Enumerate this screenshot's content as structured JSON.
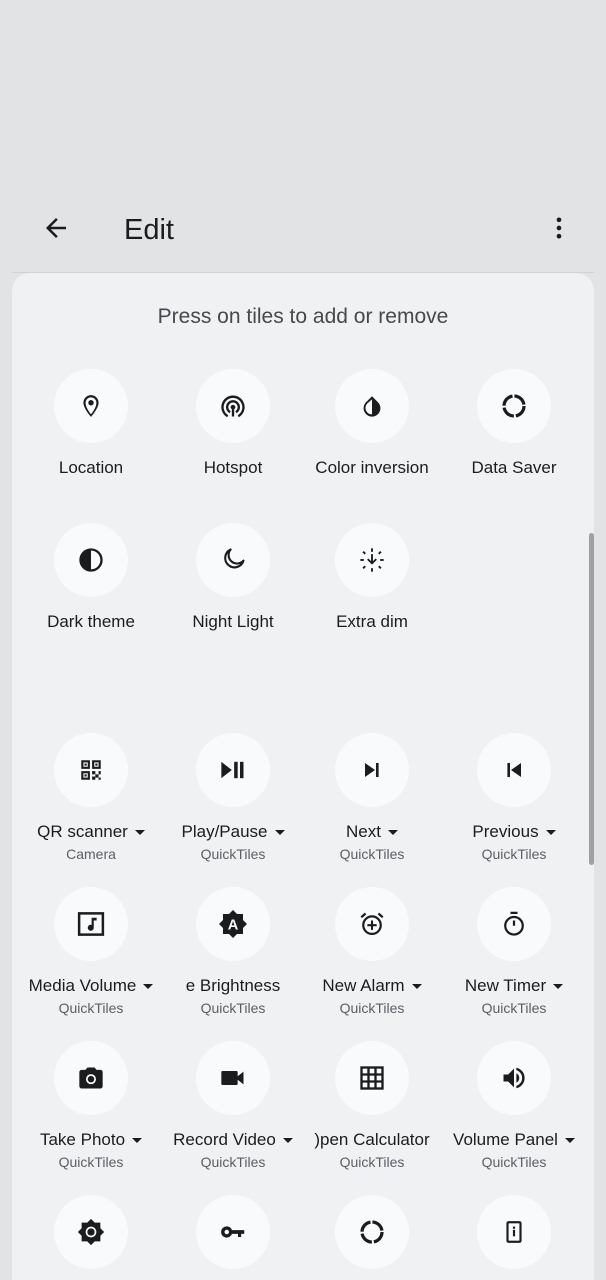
{
  "appbar": {
    "title": "Edit"
  },
  "instruction": "Press on tiles to add or remove",
  "available_tiles": [
    {
      "label": "Location",
      "icon": "location-pin-icon"
    },
    {
      "label": "Hotspot",
      "icon": "hotspot-icon"
    },
    {
      "label": "Color inversion",
      "icon": "color-inversion-icon"
    },
    {
      "label": "Data Saver",
      "icon": "data-saver-icon"
    },
    {
      "label": "Dark theme",
      "icon": "dark-theme-icon"
    },
    {
      "label": "Night Light",
      "icon": "moon-icon"
    },
    {
      "label": "Extra dim",
      "icon": "extra-dim-icon"
    }
  ],
  "app_tiles": [
    {
      "label": "QR scanner",
      "sub": "Camera",
      "icon": "qr-code-icon"
    },
    {
      "label": "Play/Pause",
      "sub": "QuickTiles",
      "icon": "play-pause-icon"
    },
    {
      "label": "Next",
      "sub": "QuickTiles",
      "icon": "skip-next-icon"
    },
    {
      "label": "Previous",
      "sub": "QuickTiles",
      "icon": "skip-previous-icon"
    },
    {
      "label": "Media Volume",
      "sub": "QuickTiles",
      "icon": "music-note-icon"
    },
    {
      "label": "e Brightness",
      "sub": "QuickTiles",
      "icon": "auto-brightness-icon"
    },
    {
      "label": "New Alarm",
      "sub": "QuickTiles",
      "icon": "alarm-add-icon"
    },
    {
      "label": "New Timer",
      "sub": "QuickTiles",
      "icon": "timer-icon"
    },
    {
      "label": "Take Photo",
      "sub": "QuickTiles",
      "icon": "camera-icon"
    },
    {
      "label": "Record Video",
      "sub": "QuickTiles",
      "icon": "videocam-icon"
    },
    {
      "label": ")pen Calculator",
      "sub": "QuickTiles",
      "icon": "calculator-grid-icon"
    },
    {
      "label": "Volume Panel",
      "sub": "QuickTiles",
      "icon": "volume-icon"
    },
    {
      "label": "",
      "sub": "",
      "icon": "brightness-gear-icon"
    },
    {
      "label": "",
      "sub": "",
      "icon": "key-icon"
    },
    {
      "label": "",
      "sub": "",
      "icon": "data-saver-icon"
    },
    {
      "label": "",
      "sub": "",
      "icon": "device-info-icon"
    }
  ]
}
